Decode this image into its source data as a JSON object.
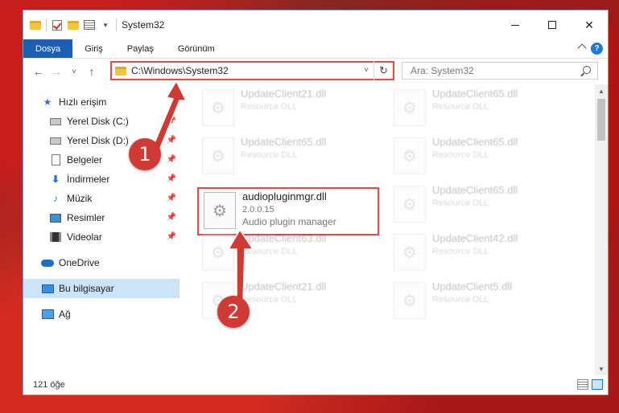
{
  "window": {
    "title": "System32",
    "controls": {
      "minimize": "",
      "maximize": "",
      "close": "✕"
    }
  },
  "ribbon": {
    "tabs": [
      "Dosya",
      "Giriş",
      "Paylaş",
      "Görünüm"
    ],
    "help": "?"
  },
  "navigation": {
    "back": "←",
    "forward": "→",
    "recent": "˅",
    "up": "↑",
    "address": "C:\\Windows\\System32",
    "address_dropdown": "˅",
    "refresh": "↻",
    "search_placeholder": "Ara: System32"
  },
  "sidebar": {
    "quick_access": "Hızlı erişim",
    "items": [
      {
        "label": "Yerel Disk (C:)",
        "icon": "drive-icon"
      },
      {
        "label": "Yerel Disk (D:)",
        "icon": "drive-icon"
      },
      {
        "label": "Belgeler",
        "icon": "document-icon"
      },
      {
        "label": "İndirmeler",
        "icon": "download-icon"
      },
      {
        "label": "Müzik",
        "icon": "music-icon"
      },
      {
        "label": "Resimler",
        "icon": "pictures-icon"
      },
      {
        "label": "Videolar",
        "icon": "video-icon"
      }
    ],
    "onedrive": "OneDrive",
    "this_pc": "Bu bilgisayar",
    "network": "Ağ"
  },
  "files": [
    {
      "name": "UpdateClient21.dll",
      "desc": "Resource DLL"
    },
    {
      "name": "UpdateClient65.dll",
      "desc": "Resource DLL"
    },
    {
      "name": "UpdateClient65.dll",
      "desc": "Resource DLL"
    },
    {
      "name": "UpdateClient65.dll",
      "desc": "Resource DLL"
    },
    {
      "name": "audiopluginmgr.dll",
      "version": "2.0.0.15",
      "desc": "Audio plugin manager"
    },
    {
      "name": "UpdateClient65.dll",
      "desc": "Resource DLL"
    },
    {
      "name": "UpdateClient63.dll",
      "desc": "Resource DLL"
    },
    {
      "name": "UpdateClient42.dll",
      "desc": "Resource DLL"
    },
    {
      "name": "UpdateClient21.dll",
      "desc": "Resource DLL"
    },
    {
      "name": "UpdateClient5.dll",
      "desc": "Resource DLL"
    }
  ],
  "status": {
    "item_count": "121 öğe"
  },
  "callouts": [
    "1",
    "2"
  ],
  "colors": {
    "accent": "#1a5fb4",
    "highlight": "#e14b4b",
    "callout": "#d03a35"
  }
}
